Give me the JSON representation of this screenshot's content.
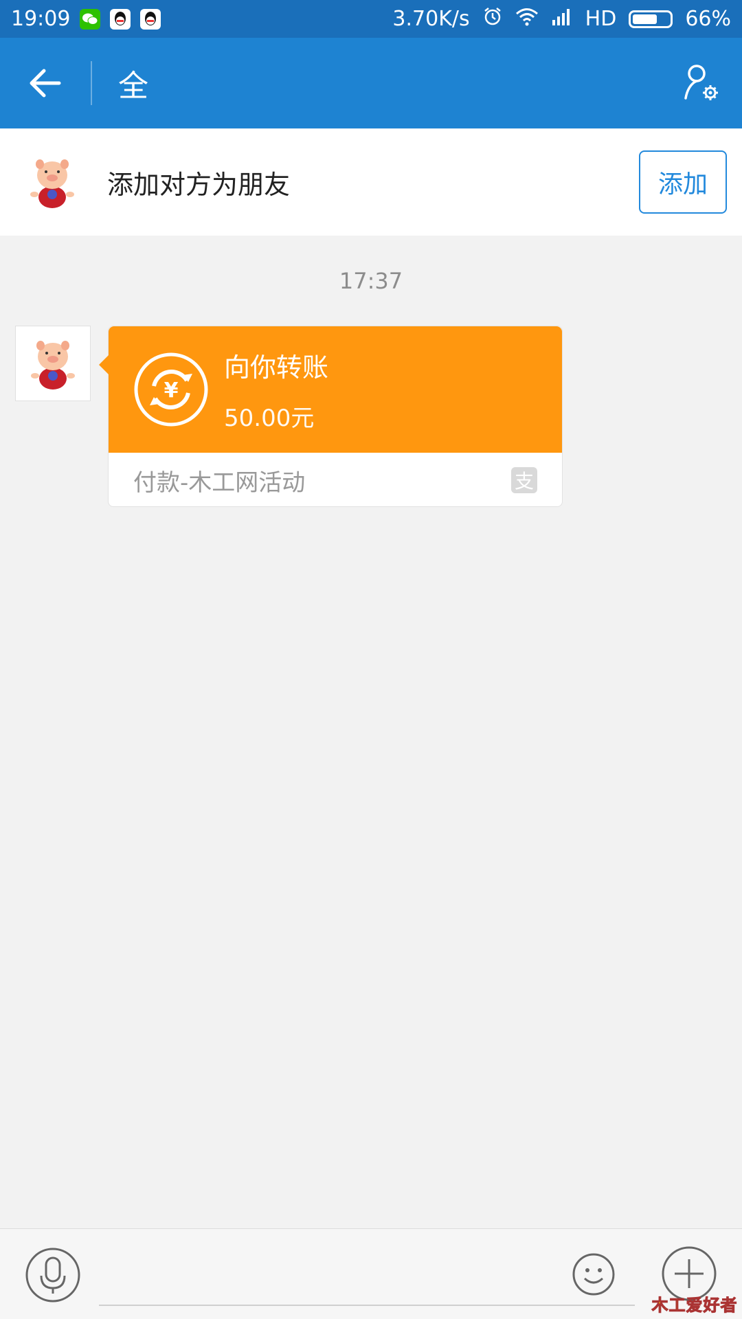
{
  "status_bar": {
    "time": "19:09",
    "network_speed": "3.70K/s",
    "signal_label": "HD",
    "battery_percent_text": "66%",
    "battery_level": 0.66
  },
  "app_bar": {
    "title": "全"
  },
  "add_friend_banner": {
    "text": "添加对方为朋友",
    "button_label": "添加"
  },
  "chat": {
    "timestamp": "17:37",
    "transfer_message": {
      "title": "向你转账",
      "amount": "50.00元",
      "description": "付款-木工网活动",
      "icon_symbol": "¥",
      "alipay_mark": "支"
    }
  },
  "watermark": {
    "text": "爱好者",
    "prefix": "木工"
  },
  "colors": {
    "status_bar": "#1a6fba",
    "app_bar": "#1e83d2",
    "transfer_orange": "#ff970f",
    "button_blue": "#2289dc",
    "background": "#f2f2f2"
  },
  "icons": {
    "back": "arrow-left-icon",
    "profile_settings": "profile-settings-icon",
    "voice": "microphone-icon",
    "emoji": "smiley-icon",
    "plus": "plus-circle-icon",
    "alipay": "alipay-icon"
  }
}
